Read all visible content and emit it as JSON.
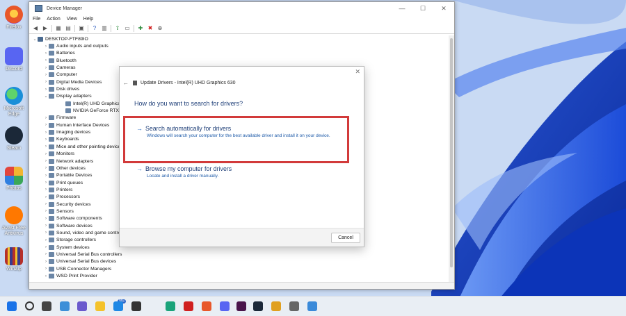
{
  "desktop": {
    "icons": [
      {
        "label": "Firefox",
        "icon": "firefox-icon",
        "color": "#e8572a"
      },
      {
        "label": "Discord",
        "icon": "discord-icon",
        "color": "#5865f2"
      },
      {
        "label": "Microsoft Edge",
        "icon": "edge-icon",
        "color": "#1a8fd8"
      },
      {
        "label": "Steam",
        "icon": "steam-icon",
        "color": "#1b2838"
      },
      {
        "label": "Photos",
        "icon": "photos-icon",
        "color": "#f2b531"
      },
      {
        "label": "Avast Free Antivirus",
        "icon": "avast-icon",
        "color": "#ff7800"
      },
      {
        "label": "WinZip",
        "icon": "winzip-icon",
        "color": "#b5302a"
      }
    ]
  },
  "device_manager": {
    "title": "Device Manager",
    "menu": [
      "File",
      "Action",
      "View",
      "Help"
    ],
    "root": "DESKTOP-FTF89IO",
    "tree": [
      {
        "label": "Audio inputs and outputs",
        "expanded": false,
        "level": 1
      },
      {
        "label": "Batteries",
        "expanded": false,
        "level": 1
      },
      {
        "label": "Bluetooth",
        "expanded": false,
        "level": 1
      },
      {
        "label": "Cameras",
        "expanded": false,
        "level": 1
      },
      {
        "label": "Computer",
        "expanded": false,
        "level": 1
      },
      {
        "label": "Digital Media Devices",
        "expanded": false,
        "level": 1
      },
      {
        "label": "Disk drives",
        "expanded": false,
        "level": 1
      },
      {
        "label": "Display adapters",
        "expanded": true,
        "level": 1
      },
      {
        "label": "Intel(R) UHD Graphics 630",
        "expanded": null,
        "level": 2
      },
      {
        "label": "NVIDIA GeForce RTX 2060",
        "expanded": null,
        "level": 2
      },
      {
        "label": "Firmware",
        "expanded": false,
        "level": 1
      },
      {
        "label": "Human Interface Devices",
        "expanded": false,
        "level": 1
      },
      {
        "label": "Imaging devices",
        "expanded": false,
        "level": 1
      },
      {
        "label": "Keyboards",
        "expanded": false,
        "level": 1
      },
      {
        "label": "Mice and other pointing devices",
        "expanded": false,
        "level": 1
      },
      {
        "label": "Monitors",
        "expanded": false,
        "level": 1
      },
      {
        "label": "Network adapters",
        "expanded": false,
        "level": 1
      },
      {
        "label": "Other devices",
        "expanded": false,
        "level": 1
      },
      {
        "label": "Portable Devices",
        "expanded": false,
        "level": 1
      },
      {
        "label": "Print queues",
        "expanded": false,
        "level": 1
      },
      {
        "label": "Printers",
        "expanded": false,
        "level": 1
      },
      {
        "label": "Processors",
        "expanded": false,
        "level": 1
      },
      {
        "label": "Security devices",
        "expanded": false,
        "level": 1
      },
      {
        "label": "Sensors",
        "expanded": false,
        "level": 1
      },
      {
        "label": "Software components",
        "expanded": false,
        "level": 1
      },
      {
        "label": "Software devices",
        "expanded": false,
        "level": 1
      },
      {
        "label": "Sound, video and game controllers",
        "expanded": false,
        "level": 1
      },
      {
        "label": "Storage controllers",
        "expanded": false,
        "level": 1
      },
      {
        "label": "System devices",
        "expanded": false,
        "level": 1
      },
      {
        "label": "Universal Serial Bus controllers",
        "expanded": false,
        "level": 1
      },
      {
        "label": "Universal Serial Bus devices",
        "expanded": false,
        "level": 1
      },
      {
        "label": "USB Connector Managers",
        "expanded": false,
        "level": 1
      },
      {
        "label": "WSD Print Provider",
        "expanded": false,
        "level": 1
      }
    ]
  },
  "dialog": {
    "header": "Update Drivers - Intel(R) UHD Graphics 630",
    "question": "How do you want to search for drivers?",
    "option_auto": {
      "title": "Search automatically for drivers",
      "description": "Windows will search your computer for the best available driver and install it on your device."
    },
    "option_browse": {
      "title": "Browse my computer for drivers",
      "description": "Locate and install a driver manually."
    },
    "cancel_label": "Cancel",
    "highlight_color": "#d23a3a"
  },
  "taskbar": {
    "badge": "99+",
    "icons": [
      "windows-start-icon",
      "search-icon",
      "task-view-icon",
      "widgets-icon",
      "chat-icon",
      "file-explorer-icon",
      "mail-icon",
      "store-icon",
      "edge-icon",
      "wps-icon",
      "firefox-icon",
      "discord-icon",
      "slack-icon",
      "steam-icon",
      "app-icon",
      "app-icon",
      "snipping-tool-icon"
    ]
  }
}
